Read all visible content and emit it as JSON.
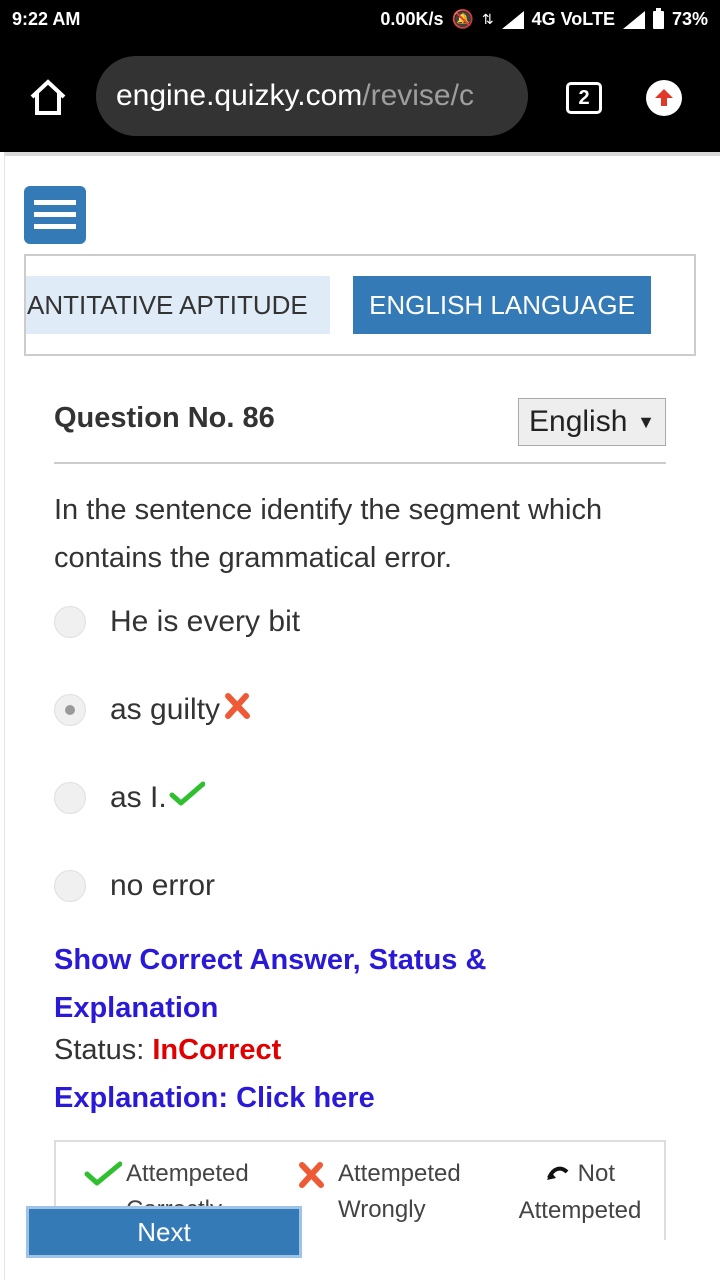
{
  "status_bar": {
    "time": "9:22 AM",
    "net_speed": "0.00K/s",
    "network": "4G VoLTE",
    "battery": "73%"
  },
  "browser": {
    "url_host": "engine.quizky.com",
    "url_path": "/revise/c",
    "tab_count": "2"
  },
  "subjects": {
    "tab1": "ANTITATIVE APTITUDE",
    "tab2": "ENGLISH LANGUAGE"
  },
  "question": {
    "title": "Question No. 86",
    "language": "English",
    "text": "In the sentence identify the segment which contains the grammatical error.",
    "options": [
      {
        "label": "He is every bit",
        "selected": false
      },
      {
        "label": "as guilty",
        "selected": true,
        "mark": "wrong"
      },
      {
        "label": "as I.",
        "selected": false,
        "mark": "correct"
      },
      {
        "label": "no error",
        "selected": false
      }
    ]
  },
  "answer": {
    "show_link": "Show Correct Answer, Status & Explanation",
    "status_label": "Status:",
    "status_value": "InCorrect",
    "explanation_link": "Explanation: Click here"
  },
  "legend": {
    "correct": "Attempeted Correctly",
    "wrong": "Attempeted Wrongly",
    "not_attempted": "Not Attempeted"
  },
  "next_label": "Next",
  "colors": {
    "primary": "#337ab7",
    "link": "#2a1ad8",
    "error": "#e00000",
    "correct_mark": "#2fbf2f",
    "wrong_mark": "#ee5a35"
  }
}
